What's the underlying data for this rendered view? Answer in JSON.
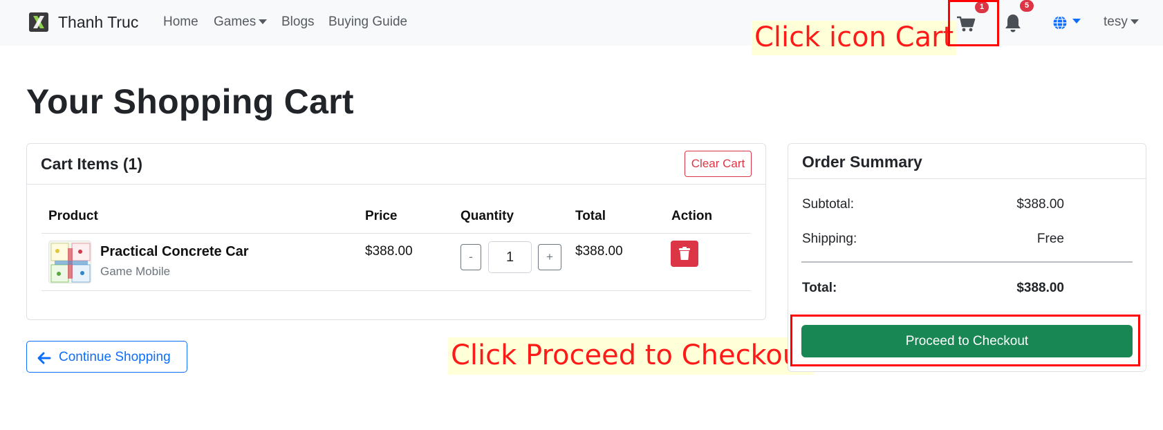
{
  "navbar": {
    "brand_name": "Thanh Truc",
    "links": [
      "Home",
      "Games",
      "Blogs",
      "Buying Guide"
    ],
    "cart_badge": "1",
    "notification_badge": "5",
    "user_name": "tesy"
  },
  "annotations": {
    "cart_hint": "Click icon Cart",
    "checkout_hint": "Click Proceed to Checkout"
  },
  "page_title": "Your Shopping Cart",
  "cart": {
    "header": "Cart Items (1)",
    "clear_label": "Clear Cart",
    "columns": [
      "Product",
      "Price",
      "Quantity",
      "Total",
      "Action"
    ],
    "items": [
      {
        "name": "Practical Concrete Car",
        "category": "Game Mobile",
        "price": "$388.00",
        "quantity": "1",
        "total": "$388.00"
      }
    ],
    "qty_minus": "-",
    "qty_plus": "+"
  },
  "continue_label": "Continue Shopping",
  "summary": {
    "title": "Order Summary",
    "subtotal_label": "Subtotal:",
    "subtotal_value": "$388.00",
    "shipping_label": "Shipping:",
    "shipping_value": "Free",
    "total_label": "Total:",
    "total_value": "$388.00",
    "checkout_label": "Proceed to Checkout"
  },
  "colors": {
    "primary": "#0d6efd",
    "danger": "#dc3545",
    "success": "#198754",
    "annotation_red": "#ff0000",
    "annotation_bg": "#ffffd8"
  }
}
